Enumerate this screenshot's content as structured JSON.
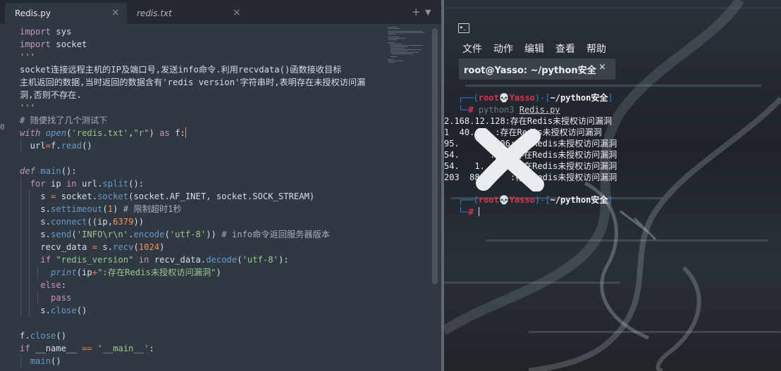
{
  "editor": {
    "tabs": [
      {
        "name": "Redis.py",
        "close": "×"
      },
      {
        "name": "redis.txt",
        "close": "×"
      }
    ],
    "tabbar_buttons": {
      "add": "+",
      "menu": "▼"
    },
    "gutter_marker": "0",
    "code_lines": [
      "import sys",
      "import socket",
      "'''",
      "socket连接远程主机的IP及端口号,发送info命令.利用recvdata()函数接收目标",
      "主机返回的数据,当时返回的数据含有'redis version'字符串时,表明存在未授权访问漏",
      "洞,否则不存在.",
      "'''",
      "# 随便找了几个测试下",
      "with open('redis.txt','r') as f:",
      "  url=f.read()",
      "",
      "def main():",
      "  for ip in url.split():",
      "    s = socket.socket(socket.AF_INET, socket.SOCK_STREAM)",
      "    s.settimeout(1) # 限制超时1秒",
      "    s.connect((ip,6379))",
      "    s.send('INFO\\r\\n'.encode('utf-8')) # info命令返回服务器版本",
      "    recv_data = s.recv(1024)",
      "    if \"redis_version\" in recv_data.decode('utf-8'):",
      "      print(ip+\":存在Redis未授权访问漏洞\")",
      "    else:",
      "      pass",
      "    s.close()",
      "",
      "f.close()",
      "if __name__ == '__main__':",
      "  main()"
    ]
  },
  "terminal": {
    "menu": [
      "文件",
      "动作",
      "编辑",
      "查看",
      "帮助"
    ],
    "tab_title": "root@Yasso: ~/python安全",
    "tab_close": "×",
    "prompt": {
      "open": "┌──(",
      "user": "root",
      "skull": "💀",
      "host": "Yasso",
      "close_mid": ")-[",
      "dir": "~/python安全",
      "close_end": "]",
      "second_line": "└─",
      "hash": "#"
    },
    "command": "python3",
    "command_arg": "Redis.py",
    "output_lines": [
      "2.168.12.128:存在Redis未授权访问漏洞",
      "1  40.    :存在Redis未授权访问漏洞",
      "95.     1.106:存在Redis未授权访问漏洞",
      "54.      .141:存在Redis未授权访问漏洞",
      "54.   1.   40:存在Redis未授权访问漏洞",
      "203  88  .   :存在Redis未授权访问漏洞"
    ]
  }
}
